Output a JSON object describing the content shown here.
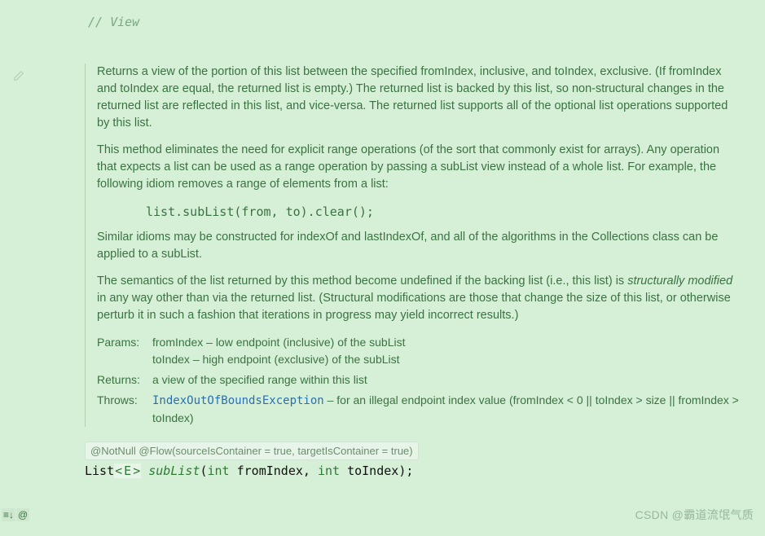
{
  "comment": "// View",
  "paragraphs": {
    "p1": "Returns a view of the portion of this list between the specified fromIndex, inclusive, and toIndex, exclusive. (If fromIndex and toIndex are equal, the returned list is empty.) The returned list is backed by this list, so non-structural changes in the returned list are reflected in this list, and vice-versa. The returned list supports all of the optional list operations supported by this list.",
    "p2": "This method eliminates the need for explicit range operations (of the sort that commonly exist for arrays). Any operation that expects a list can be used as a range operation by passing a subList view instead of a whole list. For example, the following idiom removes a range of elements from a list:",
    "code1": "list.subList(from, to).clear();",
    "p3": "Similar idioms may be constructed for indexOf and lastIndexOf, and all of the algorithms in the Collections class can be applied to a subList.",
    "p4_a": "The semantics of the list returned by this method become undefined if the backing list (i.e., this list) is ",
    "p4_em": "structurally modified",
    "p4_b": " in any way other than via the returned list. (Structural modifications are those that change the size of this list, or otherwise perturb it in such a fashion that iterations in progress may yield incorrect results.)"
  },
  "details": {
    "params_label": "Params:",
    "params_value1": "fromIndex – low endpoint (inclusive) of the subList",
    "params_value2": "toIndex – high endpoint (exclusive) of the subList",
    "returns_label": "Returns:",
    "returns_value": "a view of the specified range within this list",
    "throws_label": "Throws:",
    "throws_link": "IndexOutOfBoundsException",
    "throws_rest": " – for an illegal endpoint index value (fromIndex < 0 || toIndex > size || fromIndex > toIndex)"
  },
  "annotation": "@NotNull    @Flow(sourceIsContainer = true, targetIsContainer = true)",
  "signature": {
    "return_type": "List",
    "generic_open": "<",
    "generic_param": "E",
    "generic_close": ">",
    "space1": " ",
    "method_name": "subList",
    "paren_open": "(",
    "kw_int1": "int",
    "sp1": " ",
    "param1": "fromIndex",
    "comma": ", ",
    "kw_int2": "int",
    "sp2": " ",
    "param2": "toIndex",
    "paren_close": ");"
  },
  "gutter": {
    "bottom1": "≡↓",
    "bottom2": "@"
  },
  "watermark": "CSDN @霸道流氓气质"
}
